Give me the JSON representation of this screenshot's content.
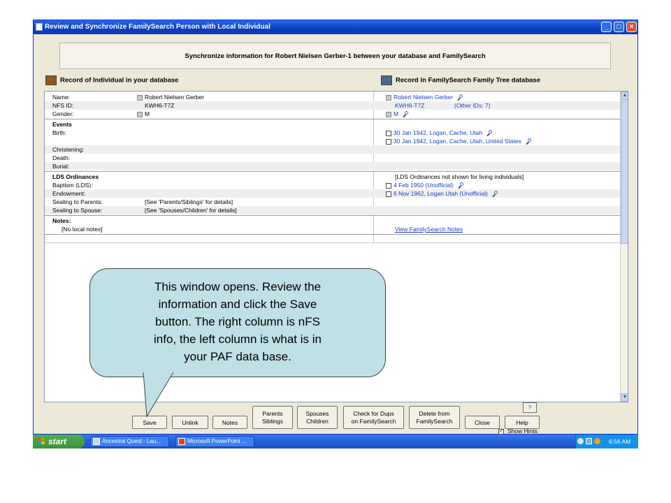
{
  "window": {
    "title": "Review and Synchronize FamilySearch Person with Local Individual",
    "controls": {
      "minimize": "_",
      "maximize": "□",
      "close": "×"
    }
  },
  "header": {
    "sync_text": "Synchronize information for Robert Nielsen Gerber-1 between your database and FamilySearch"
  },
  "columns": {
    "left": "Record of Individual in your database",
    "right": "Record in FamilySearch Family Tree database"
  },
  "record": {
    "name_label": "Name:",
    "name_local": "Robert Nielsen Gerber",
    "name_fs": "Robert Nielsen Gerber",
    "nfsid_label": "NFS ID:",
    "nfsid_local": "KWH6-T7Z",
    "nfsid_fs": "KWH6-T7Z",
    "other_ids": "(Other IDs: 7)",
    "gender_label": "Gender:",
    "gender_local": "M",
    "gender_fs": "M",
    "events_heading": "Events",
    "birth_label": "Birth:",
    "birth_fs_1": "30 Jan 1942, Logan, Cache, Utah",
    "birth_fs_2": "30 Jan 1942, Logan, Cache, Utah, United States",
    "christening_label": "Christening:",
    "death_label": "Death:",
    "burial_label": "Burial:",
    "lds_heading": "LDS Ordinances",
    "lds_note": "[LDS Ordinances not shown for living individuals]",
    "baptism_label": "Baptism (LDS):",
    "baptism_fs": "4 Feb 1950 (Unofficial)",
    "endowment_label": "Endowment:",
    "endowment_fs": "6 Nov 1962, Logan Utah (Unofficial)",
    "sealing_parents_label": "Sealing to Parents:",
    "sealing_parents_local": "[See 'Parents/Siblings' for details]",
    "sealing_spouse_label": "Sealing to Spouse:",
    "sealing_spouse_local": "[See 'Spouses/Children' for details]",
    "notes_heading": "Notes:",
    "notes_local": "[No local notes]",
    "notes_fs_link": "View FamilySearch Notes"
  },
  "callout": {
    "line1": "This window opens.  Review the",
    "line2": "information and click the Save",
    "line3": "button.  The right column is nFS",
    "line4": "info, the left column is what is in",
    "line5": "your PAF data base."
  },
  "buttons": {
    "save": "Save",
    "unlink": "Unlink",
    "notes": "Notes",
    "parents_1": "Parents",
    "parents_2": "Siblings",
    "spouses_1": "Spouses",
    "spouses_2": "Children",
    "dups_1": "Check for Dups",
    "dups_2": "on FamilySearch",
    "delete_1": "Delete from",
    "delete_2": "FamilySearch",
    "show_hints": "Show Hints",
    "show_hints_checked": "✓",
    "close": "Close",
    "help": "Help"
  },
  "taskbar": {
    "start": "start",
    "task1": "Ancestral Quest - Lau...",
    "task2": "Microsoft PowerPoint ...",
    "time": "6:56 AM"
  },
  "colors": {
    "title_blue": "#0a3fc2",
    "link_blue": "#1a3cc8",
    "callout_fill": "#bfe0e7",
    "start_green": "#3a933a"
  }
}
